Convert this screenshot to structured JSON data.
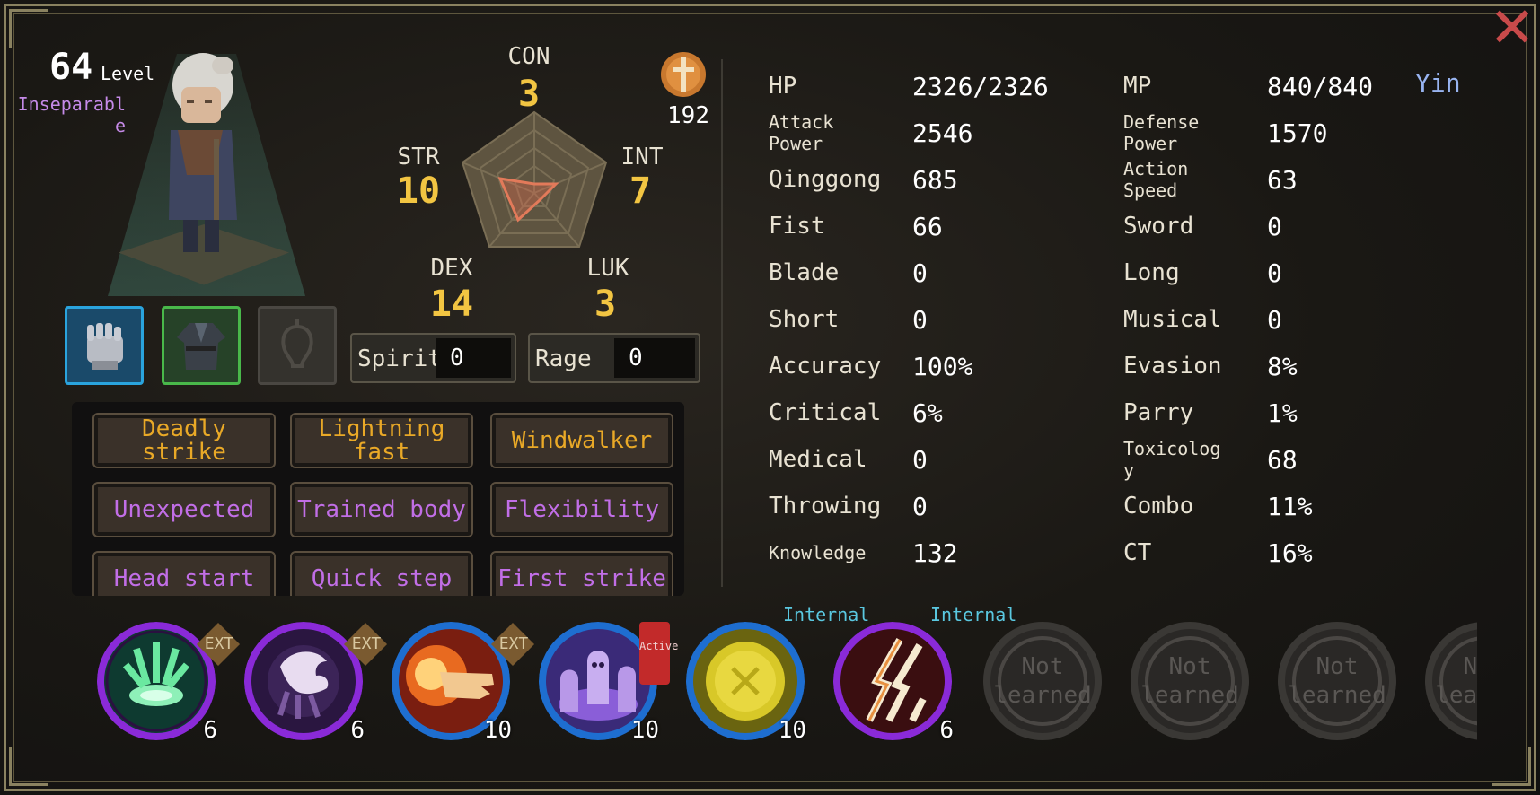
{
  "character": {
    "level": "64",
    "level_label": "Level",
    "title": "Inseparable",
    "portrait": "elderly-woman-sprite"
  },
  "equipment": [
    {
      "name": "gauntlet-icon",
      "rarity_color": "#2aa4de"
    },
    {
      "name": "robe-icon",
      "rarity_color": "#49b84a"
    },
    {
      "name": "accessory-empty-icon",
      "rarity_color": "#4a4742"
    }
  ],
  "attributes": {
    "con": {
      "label": "CON",
      "value": "3"
    },
    "str": {
      "label": "STR",
      "value": "10"
    },
    "int": {
      "label": "INT",
      "value": "7"
    },
    "dex": {
      "label": "DEX",
      "value": "14"
    },
    "luk": {
      "label": "LUK",
      "value": "3"
    }
  },
  "emblem": {
    "icon": "sword-emblem-icon",
    "value": "192"
  },
  "gauges": {
    "spirit": {
      "label": "Spirit",
      "value": "0"
    },
    "rage": {
      "label": "Rage",
      "value": "0"
    }
  },
  "traits": [
    {
      "label": "Deadly strike",
      "color": "#e9a927"
    },
    {
      "label": "Lightning fast",
      "color": "#e9a927"
    },
    {
      "label": "Windwalker",
      "color": "#e9a927"
    },
    {
      "label": "Unexpected",
      "color": "#c16ee6"
    },
    {
      "label": "Trained body",
      "color": "#c16ee6"
    },
    {
      "label": "Flexibility",
      "color": "#c16ee6"
    },
    {
      "label": "Head start",
      "color": "#c16ee6"
    },
    {
      "label": "Quick step",
      "color": "#c16ee6"
    },
    {
      "label": "First strike",
      "color": "#c16ee6"
    }
  ],
  "stats_left": [
    {
      "label": "HP",
      "value": "2326/2326"
    },
    {
      "label": "Attack Power",
      "value": "2546"
    },
    {
      "label": "Qinggong",
      "value": "685"
    },
    {
      "label": "Fist",
      "value": "66"
    },
    {
      "label": "Blade",
      "value": "0"
    },
    {
      "label": "Short",
      "value": "0"
    },
    {
      "label": "Accuracy",
      "value": "100%"
    },
    {
      "label": "Critical",
      "value": "6%"
    },
    {
      "label": "Medical",
      "value": "0"
    },
    {
      "label": "Throwing",
      "value": "0"
    },
    {
      "label": "Knowledge",
      "value": "132"
    }
  ],
  "stats_right": [
    {
      "label": "MP",
      "value": "840/840"
    },
    {
      "label": "Defense Power",
      "value": "1570"
    },
    {
      "label": "Action Speed",
      "value": "63"
    },
    {
      "label": "Sword",
      "value": "0"
    },
    {
      "label": "Long",
      "value": "0"
    },
    {
      "label": "Musical",
      "value": "0"
    },
    {
      "label": "Evasion",
      "value": "8%"
    },
    {
      "label": "Parry",
      "value": "1%"
    },
    {
      "label": "Toxicology",
      "value": "68"
    },
    {
      "label": "Combo",
      "value": "11%"
    },
    {
      "label": "CT",
      "value": "16%"
    }
  ],
  "alignment": "Yin",
  "skills": [
    {
      "icon": "green-aura-skill-icon",
      "level": "6",
      "badge": "EXT",
      "ring": "#8a2ad8"
    },
    {
      "icon": "ghost-hand-skill-icon",
      "level": "6",
      "badge": "EXT",
      "ring": "#8a2ad8"
    },
    {
      "icon": "fire-palm-skill-icon",
      "level": "10",
      "badge": "EXT",
      "ring": "#1e6ed0"
    },
    {
      "icon": "spirits-skill-icon",
      "level": "10",
      "badge": "Active",
      "ring": "#1e6ed0"
    },
    {
      "icon": "golden-sun-skill-icon",
      "level": "10",
      "badge": "Internal",
      "ring": "#1e6ed0"
    },
    {
      "icon": "lightning-skill-icon",
      "level": "6",
      "badge": "Internal",
      "ring": "#8a2ad8"
    }
  ],
  "empty_skill_label": "Not learned",
  "close_icon": "close-x-icon"
}
